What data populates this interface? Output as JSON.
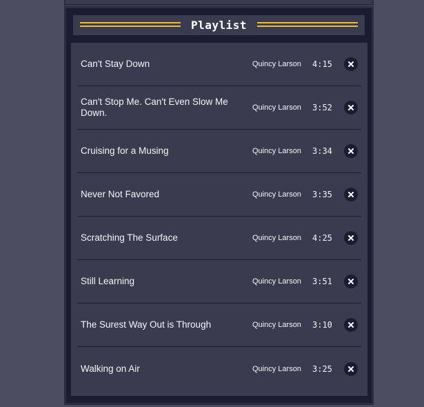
{
  "playlist": {
    "title": "Playlist",
    "accent_color": "#f1be32",
    "songs": [
      {
        "title": "Can't Stay Down",
        "artist": "Quincy Larson",
        "duration": "4:15"
      },
      {
        "title": "Can't Stop Me. Can't Even Slow Me Down.",
        "artist": "Quincy Larson",
        "duration": "3:52"
      },
      {
        "title": "Cruising for a Musing",
        "artist": "Quincy Larson",
        "duration": "3:34"
      },
      {
        "title": "Never Not Favored",
        "artist": "Quincy Larson",
        "duration": "3:35"
      },
      {
        "title": "Scratching The Surface",
        "artist": "Quincy Larson",
        "duration": "4:25"
      },
      {
        "title": "Still Learning",
        "artist": "Quincy Larson",
        "duration": "3:51"
      },
      {
        "title": "The Surest Way Out is Through",
        "artist": "Quincy Larson",
        "duration": "3:10"
      },
      {
        "title": "Walking on Air",
        "artist": "Quincy Larson",
        "duration": "3:25"
      }
    ],
    "delete_icon": "close-icon"
  }
}
